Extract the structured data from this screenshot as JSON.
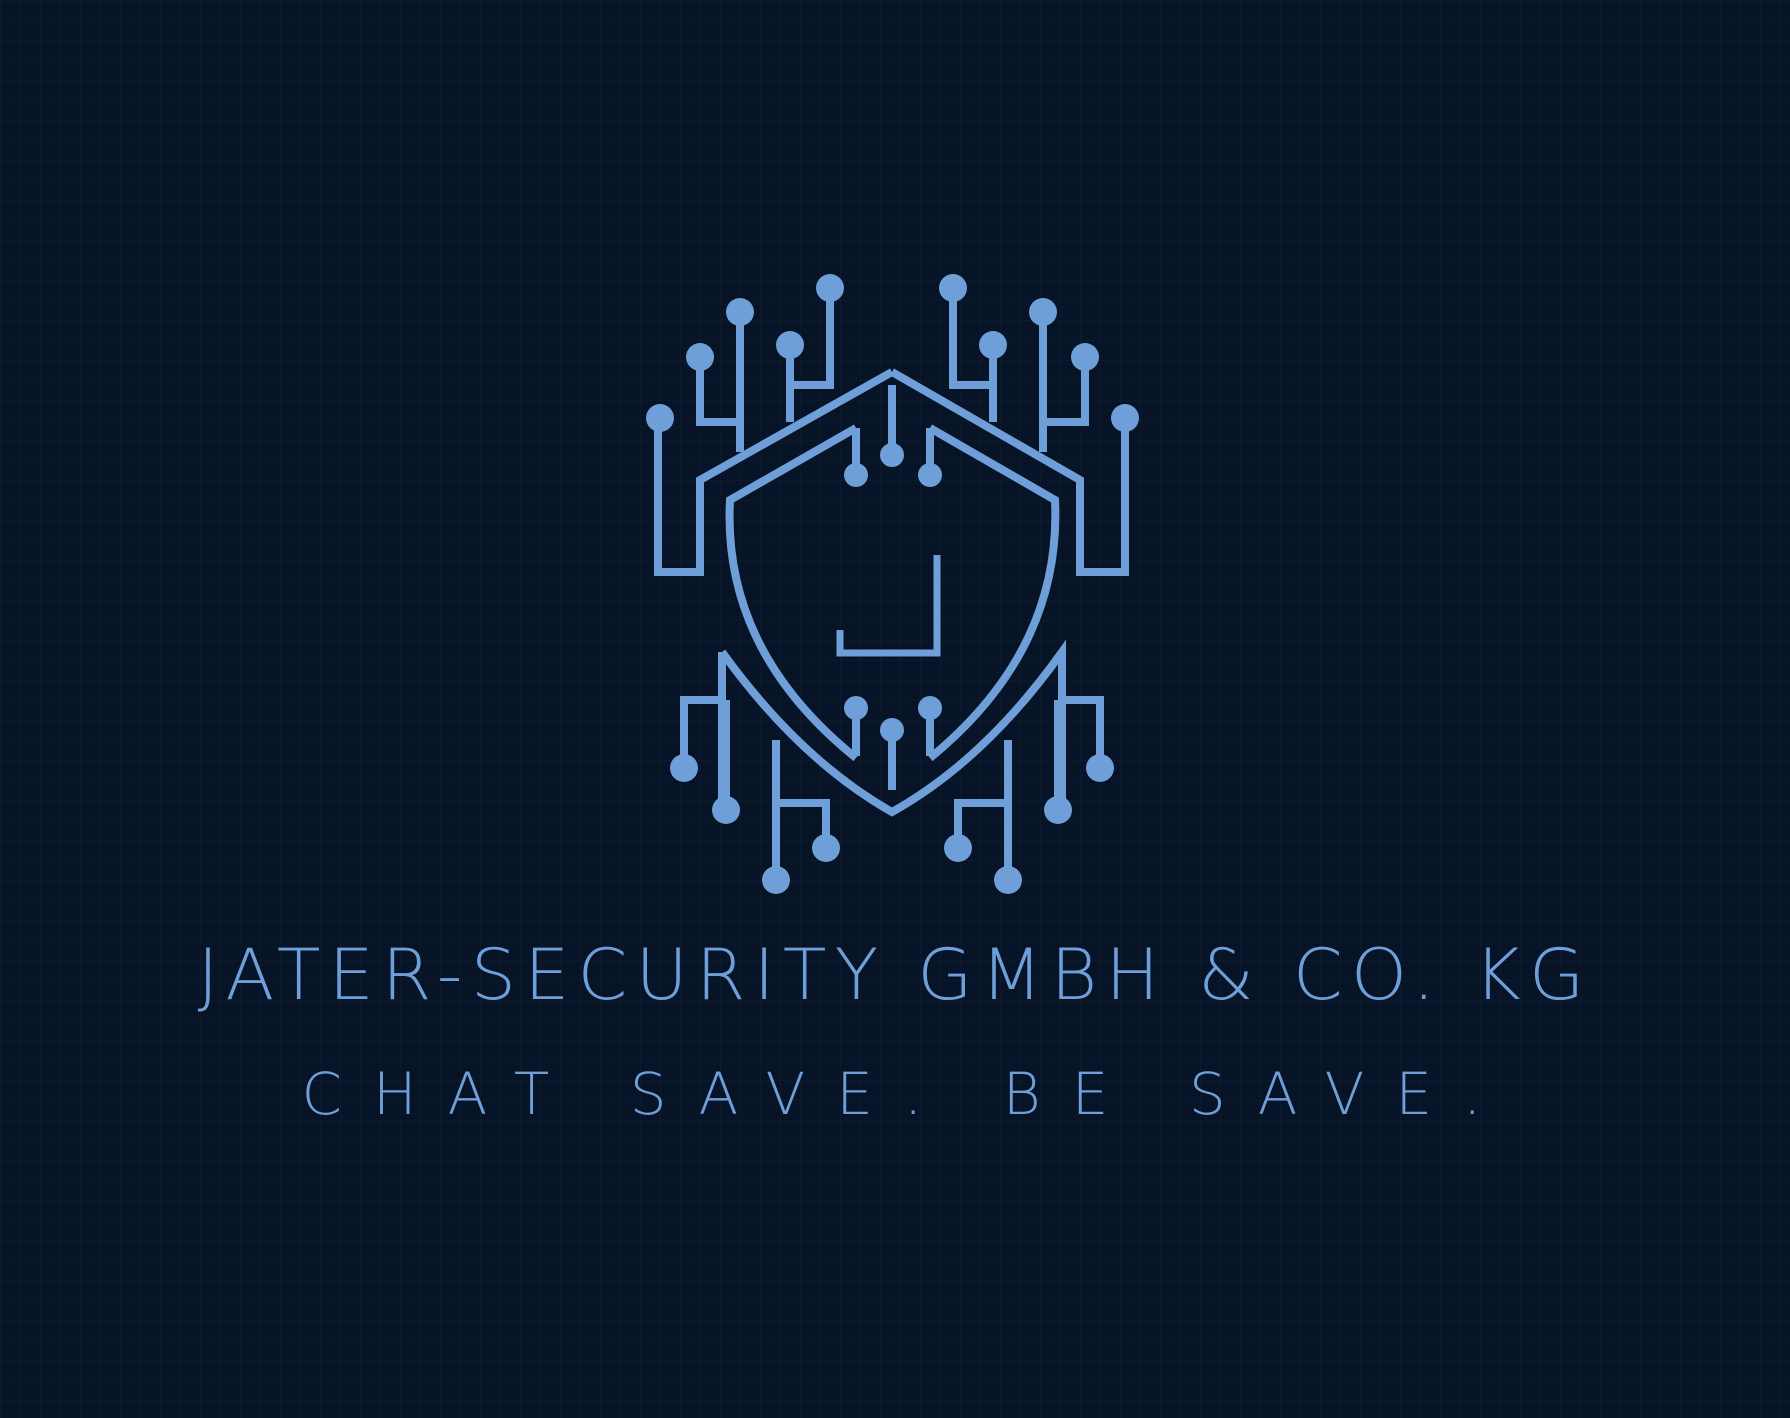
{
  "logo": {
    "monogram": "J",
    "colors": {
      "background": "#071427",
      "accent": "#6f9fd8"
    },
    "icon": "circuit-shield-icon"
  },
  "company_name": "JATER-SECURITY GMBH & CO. KG",
  "tagline": "CHAT SAVE. BE SAVE."
}
